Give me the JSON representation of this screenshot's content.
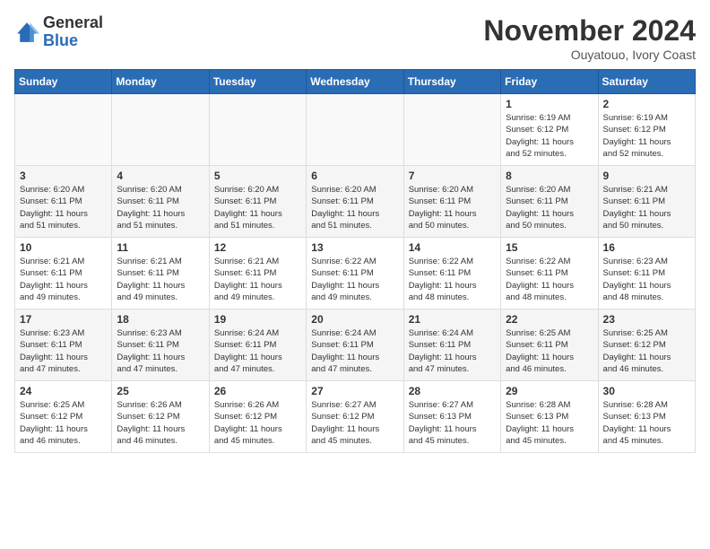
{
  "header": {
    "logo_general": "General",
    "logo_blue": "Blue",
    "month_year": "November 2024",
    "location": "Ouyatouo, Ivory Coast"
  },
  "weekdays": [
    "Sunday",
    "Monday",
    "Tuesday",
    "Wednesday",
    "Thursday",
    "Friday",
    "Saturday"
  ],
  "weeks": [
    [
      {
        "day": "",
        "info": ""
      },
      {
        "day": "",
        "info": ""
      },
      {
        "day": "",
        "info": ""
      },
      {
        "day": "",
        "info": ""
      },
      {
        "day": "",
        "info": ""
      },
      {
        "day": "1",
        "info": "Sunrise: 6:19 AM\nSunset: 6:12 PM\nDaylight: 11 hours\nand 52 minutes."
      },
      {
        "day": "2",
        "info": "Sunrise: 6:19 AM\nSunset: 6:12 PM\nDaylight: 11 hours\nand 52 minutes."
      }
    ],
    [
      {
        "day": "3",
        "info": "Sunrise: 6:20 AM\nSunset: 6:11 PM\nDaylight: 11 hours\nand 51 minutes."
      },
      {
        "day": "4",
        "info": "Sunrise: 6:20 AM\nSunset: 6:11 PM\nDaylight: 11 hours\nand 51 minutes."
      },
      {
        "day": "5",
        "info": "Sunrise: 6:20 AM\nSunset: 6:11 PM\nDaylight: 11 hours\nand 51 minutes."
      },
      {
        "day": "6",
        "info": "Sunrise: 6:20 AM\nSunset: 6:11 PM\nDaylight: 11 hours\nand 51 minutes."
      },
      {
        "day": "7",
        "info": "Sunrise: 6:20 AM\nSunset: 6:11 PM\nDaylight: 11 hours\nand 50 minutes."
      },
      {
        "day": "8",
        "info": "Sunrise: 6:20 AM\nSunset: 6:11 PM\nDaylight: 11 hours\nand 50 minutes."
      },
      {
        "day": "9",
        "info": "Sunrise: 6:21 AM\nSunset: 6:11 PM\nDaylight: 11 hours\nand 50 minutes."
      }
    ],
    [
      {
        "day": "10",
        "info": "Sunrise: 6:21 AM\nSunset: 6:11 PM\nDaylight: 11 hours\nand 49 minutes."
      },
      {
        "day": "11",
        "info": "Sunrise: 6:21 AM\nSunset: 6:11 PM\nDaylight: 11 hours\nand 49 minutes."
      },
      {
        "day": "12",
        "info": "Sunrise: 6:21 AM\nSunset: 6:11 PM\nDaylight: 11 hours\nand 49 minutes."
      },
      {
        "day": "13",
        "info": "Sunrise: 6:22 AM\nSunset: 6:11 PM\nDaylight: 11 hours\nand 49 minutes."
      },
      {
        "day": "14",
        "info": "Sunrise: 6:22 AM\nSunset: 6:11 PM\nDaylight: 11 hours\nand 48 minutes."
      },
      {
        "day": "15",
        "info": "Sunrise: 6:22 AM\nSunset: 6:11 PM\nDaylight: 11 hours\nand 48 minutes."
      },
      {
        "day": "16",
        "info": "Sunrise: 6:23 AM\nSunset: 6:11 PM\nDaylight: 11 hours\nand 48 minutes."
      }
    ],
    [
      {
        "day": "17",
        "info": "Sunrise: 6:23 AM\nSunset: 6:11 PM\nDaylight: 11 hours\nand 47 minutes."
      },
      {
        "day": "18",
        "info": "Sunrise: 6:23 AM\nSunset: 6:11 PM\nDaylight: 11 hours\nand 47 minutes."
      },
      {
        "day": "19",
        "info": "Sunrise: 6:24 AM\nSunset: 6:11 PM\nDaylight: 11 hours\nand 47 minutes."
      },
      {
        "day": "20",
        "info": "Sunrise: 6:24 AM\nSunset: 6:11 PM\nDaylight: 11 hours\nand 47 minutes."
      },
      {
        "day": "21",
        "info": "Sunrise: 6:24 AM\nSunset: 6:11 PM\nDaylight: 11 hours\nand 47 minutes."
      },
      {
        "day": "22",
        "info": "Sunrise: 6:25 AM\nSunset: 6:11 PM\nDaylight: 11 hours\nand 46 minutes."
      },
      {
        "day": "23",
        "info": "Sunrise: 6:25 AM\nSunset: 6:12 PM\nDaylight: 11 hours\nand 46 minutes."
      }
    ],
    [
      {
        "day": "24",
        "info": "Sunrise: 6:25 AM\nSunset: 6:12 PM\nDaylight: 11 hours\nand 46 minutes."
      },
      {
        "day": "25",
        "info": "Sunrise: 6:26 AM\nSunset: 6:12 PM\nDaylight: 11 hours\nand 46 minutes."
      },
      {
        "day": "26",
        "info": "Sunrise: 6:26 AM\nSunset: 6:12 PM\nDaylight: 11 hours\nand 45 minutes."
      },
      {
        "day": "27",
        "info": "Sunrise: 6:27 AM\nSunset: 6:12 PM\nDaylight: 11 hours\nand 45 minutes."
      },
      {
        "day": "28",
        "info": "Sunrise: 6:27 AM\nSunset: 6:13 PM\nDaylight: 11 hours\nand 45 minutes."
      },
      {
        "day": "29",
        "info": "Sunrise: 6:28 AM\nSunset: 6:13 PM\nDaylight: 11 hours\nand 45 minutes."
      },
      {
        "day": "30",
        "info": "Sunrise: 6:28 AM\nSunset: 6:13 PM\nDaylight: 11 hours\nand 45 minutes."
      }
    ]
  ]
}
